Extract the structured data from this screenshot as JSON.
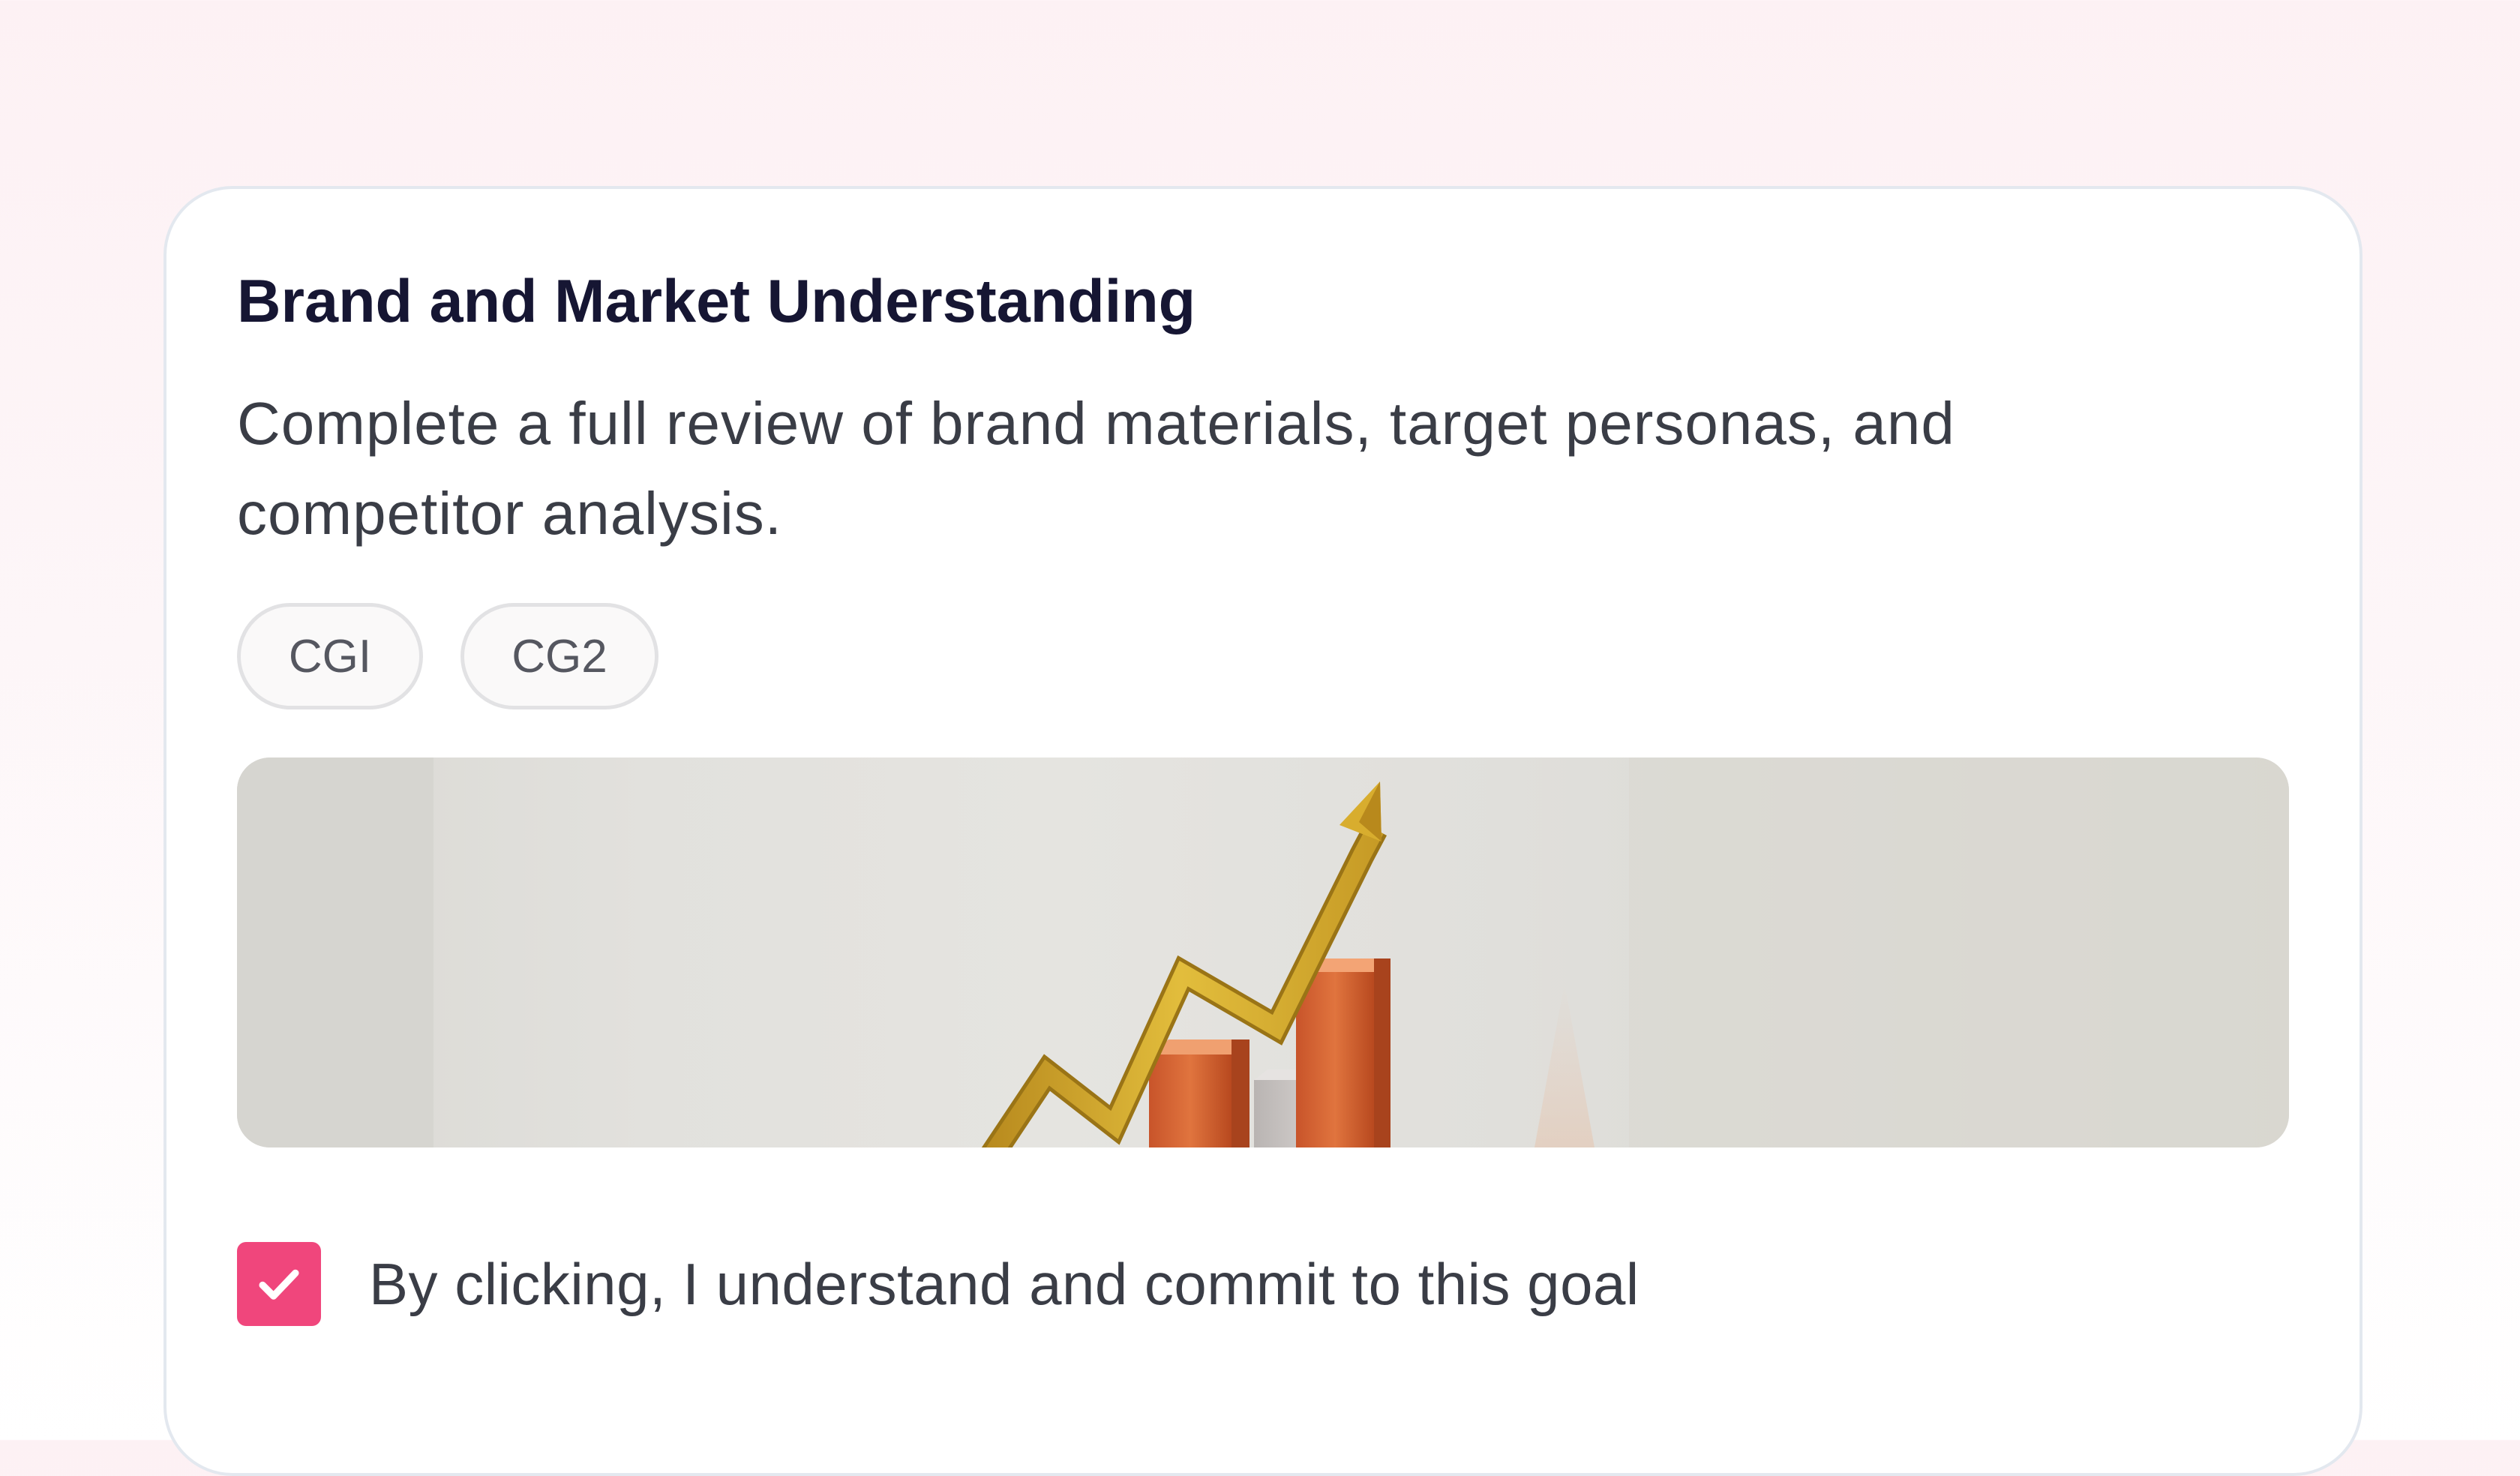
{
  "goal": {
    "title": "Brand and Market Understanding",
    "description": "Complete a full review of brand materials, target personas, and competitor analysis.",
    "tags": [
      "CGI",
      "CG2"
    ],
    "image_icon": "growth-chart-icon",
    "commitment": {
      "checked": true,
      "label": "By clicking, I understand and commit to this goal"
    }
  },
  "colors": {
    "accent": "#f0467c",
    "title": "#161633",
    "body_text": "#3a3d46",
    "card_border": "#e3e8ef"
  }
}
